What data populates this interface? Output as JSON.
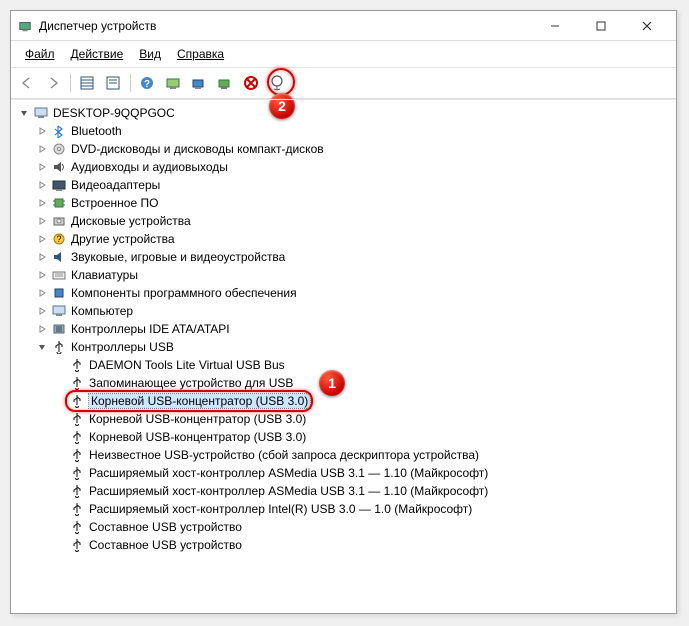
{
  "window": {
    "title": "Диспетчер устройств"
  },
  "menubar": {
    "file": "Файл",
    "action": "Действие",
    "view": "Вид",
    "help": "Справка"
  },
  "tree": {
    "root": "DESKTOP-9QQPGOC",
    "categories": [
      {
        "icon": "bluetooth",
        "label": "Bluetooth"
      },
      {
        "icon": "disc",
        "label": "DVD-дисководы и дисководы компакт-дисков"
      },
      {
        "icon": "audio",
        "label": "Аудиовходы и аудиовыходы"
      },
      {
        "icon": "video",
        "label": "Видеоадаптеры"
      },
      {
        "icon": "firmware",
        "label": "Встроенное ПО"
      },
      {
        "icon": "disk",
        "label": "Дисковые устройства"
      },
      {
        "icon": "other",
        "label": "Другие устройства"
      },
      {
        "icon": "sound",
        "label": "Звуковые, игровые и видеоустройства"
      },
      {
        "icon": "keyboard",
        "label": "Клавиатуры"
      },
      {
        "icon": "software",
        "label": "Компоненты программного обеспечения"
      },
      {
        "icon": "computer",
        "label": "Компьютер"
      },
      {
        "icon": "ide",
        "label": "Контроллеры IDE ATA/ATAPI"
      }
    ],
    "usb_category": "Контроллеры USB",
    "usb_items": [
      {
        "icon": "usb",
        "label": "DAEMON Tools Lite Virtual USB Bus"
      },
      {
        "icon": "usb",
        "label": "Запоминающее устройство для USB"
      },
      {
        "icon": "usb",
        "label": "Корневой USB-концентратор (USB 3.0)",
        "selected": true,
        "mark": true
      },
      {
        "icon": "usb",
        "label": "Корневой USB-концентратор (USB 3.0)"
      },
      {
        "icon": "usb",
        "label": "Корневой USB-концентратор (USB 3.0)"
      },
      {
        "icon": "usb",
        "label": "Неизвестное USB-устройство (сбой запроса дескриптора устройства)"
      },
      {
        "icon": "usb",
        "label": "Расширяемый хост-контроллер ASMedia USB 3.1 — 1.10 (Майкрософт)"
      },
      {
        "icon": "usb",
        "label": "Расширяемый хост-контроллер ASMedia USB 3.1 — 1.10 (Майкрософт)"
      },
      {
        "icon": "usb",
        "label": "Расширяемый хост-контроллер Intel(R) USB 3.0 — 1.0 (Майкрософт)"
      },
      {
        "icon": "usb",
        "label": "Составное USB устройство"
      },
      {
        "icon": "usb",
        "label": "Составное USB устройство"
      }
    ]
  },
  "marks": {
    "toolbar": "2",
    "row": "1"
  }
}
